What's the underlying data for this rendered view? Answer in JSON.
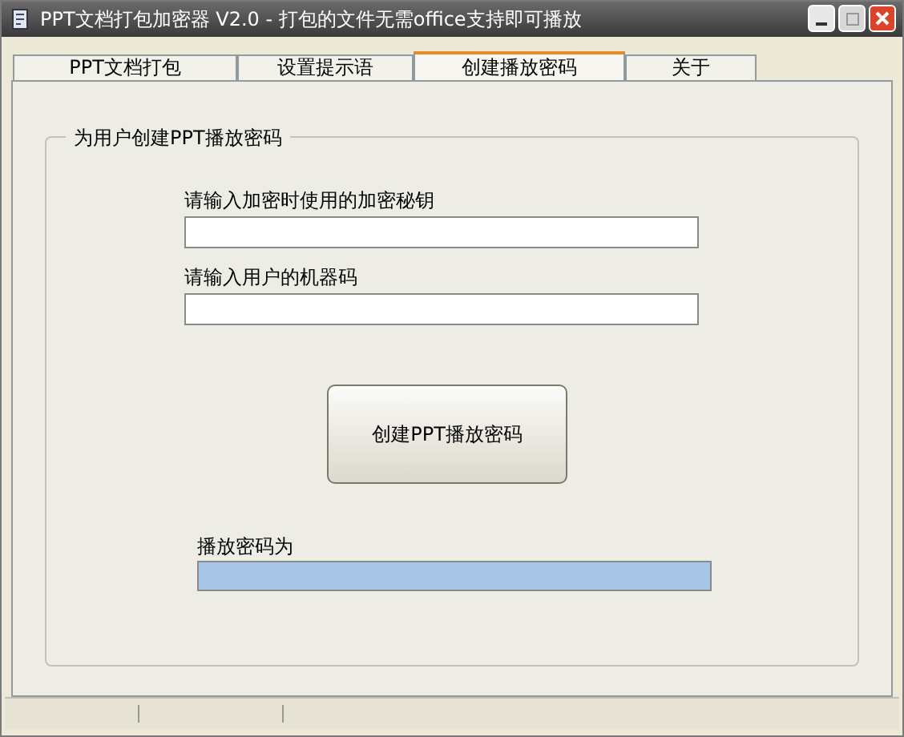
{
  "window": {
    "title": "PPT文档打包加密器 V2.0 - 打包的文件无需office支持即可播放"
  },
  "tabs": [
    {
      "label": "PPT文档打包",
      "selected": false
    },
    {
      "label": "设置提示语",
      "selected": false
    },
    {
      "label": "创建播放密码",
      "selected": true
    },
    {
      "label": "关于",
      "selected": false
    }
  ],
  "group": {
    "title": "为用户创建PPT播放密码",
    "fields": [
      {
        "label": "请输入加密时使用的加密秘钥"
      },
      {
        "label": "请输入用户的机器码"
      }
    ],
    "button": "创建PPT播放密码",
    "result": {
      "label": "播放密码为"
    }
  }
}
